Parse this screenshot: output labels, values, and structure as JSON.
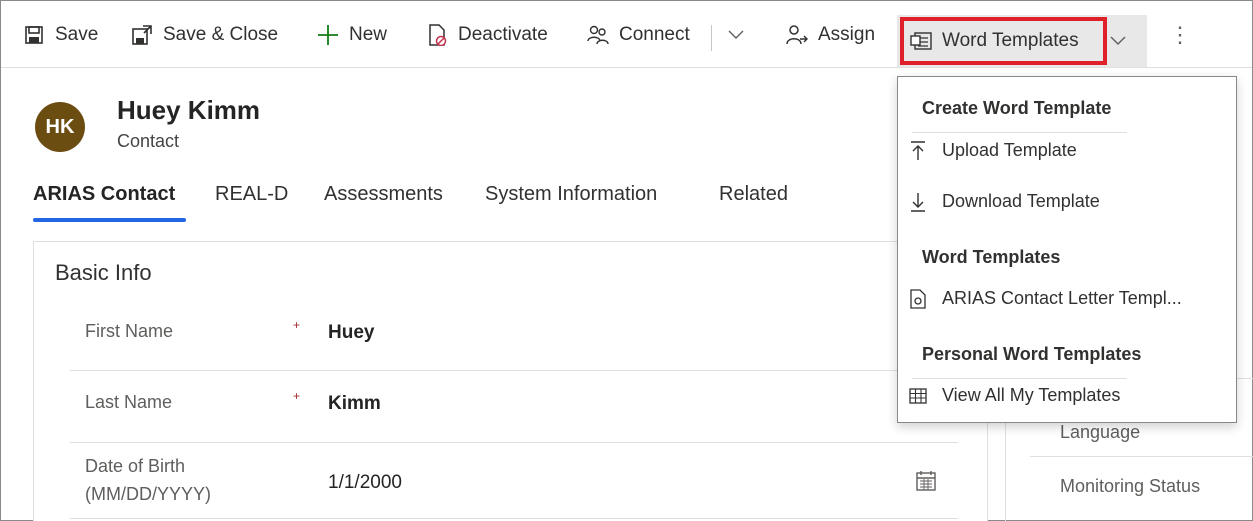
{
  "toolbar": {
    "save": "Save",
    "save_close": "Save & Close",
    "new": "New",
    "deactivate": "Deactivate",
    "connect": "Connect",
    "assign": "Assign",
    "word_templates": "Word Templates",
    "more": "⋮"
  },
  "record": {
    "initials": "HK",
    "name": "Huey Kimm",
    "entity": "Contact"
  },
  "tabs": [
    {
      "label": "ARIAS Contact",
      "active": true
    },
    {
      "label": "REAL-D"
    },
    {
      "label": "Assessments"
    },
    {
      "label": "System Information"
    },
    {
      "label": "Related"
    }
  ],
  "section": {
    "title": "Basic Info",
    "fields": [
      {
        "label": "First Name",
        "required": true,
        "value": "Huey"
      },
      {
        "label": "Last Name",
        "required": true,
        "value": "Kimm"
      },
      {
        "label_line1": "Date of Birth",
        "label_line2": "(MM/DD/YYYY)",
        "value": "1/1/2000"
      }
    ]
  },
  "side": {
    "labels": [
      "Language",
      "Monitoring Status"
    ]
  },
  "dropdown": {
    "create_header": "Create Word Template",
    "upload": "Upload Template",
    "download": "Download Template",
    "templates_header": "Word Templates",
    "template_item": "ARIAS Contact Letter Templ...",
    "personal_header": "Personal Word Templates",
    "view_all": "View All My Templates"
  },
  "colors": {
    "highlight_border": "#e02028",
    "avatar_bg": "#6b4d12",
    "tab_underline": "#2266e3"
  }
}
